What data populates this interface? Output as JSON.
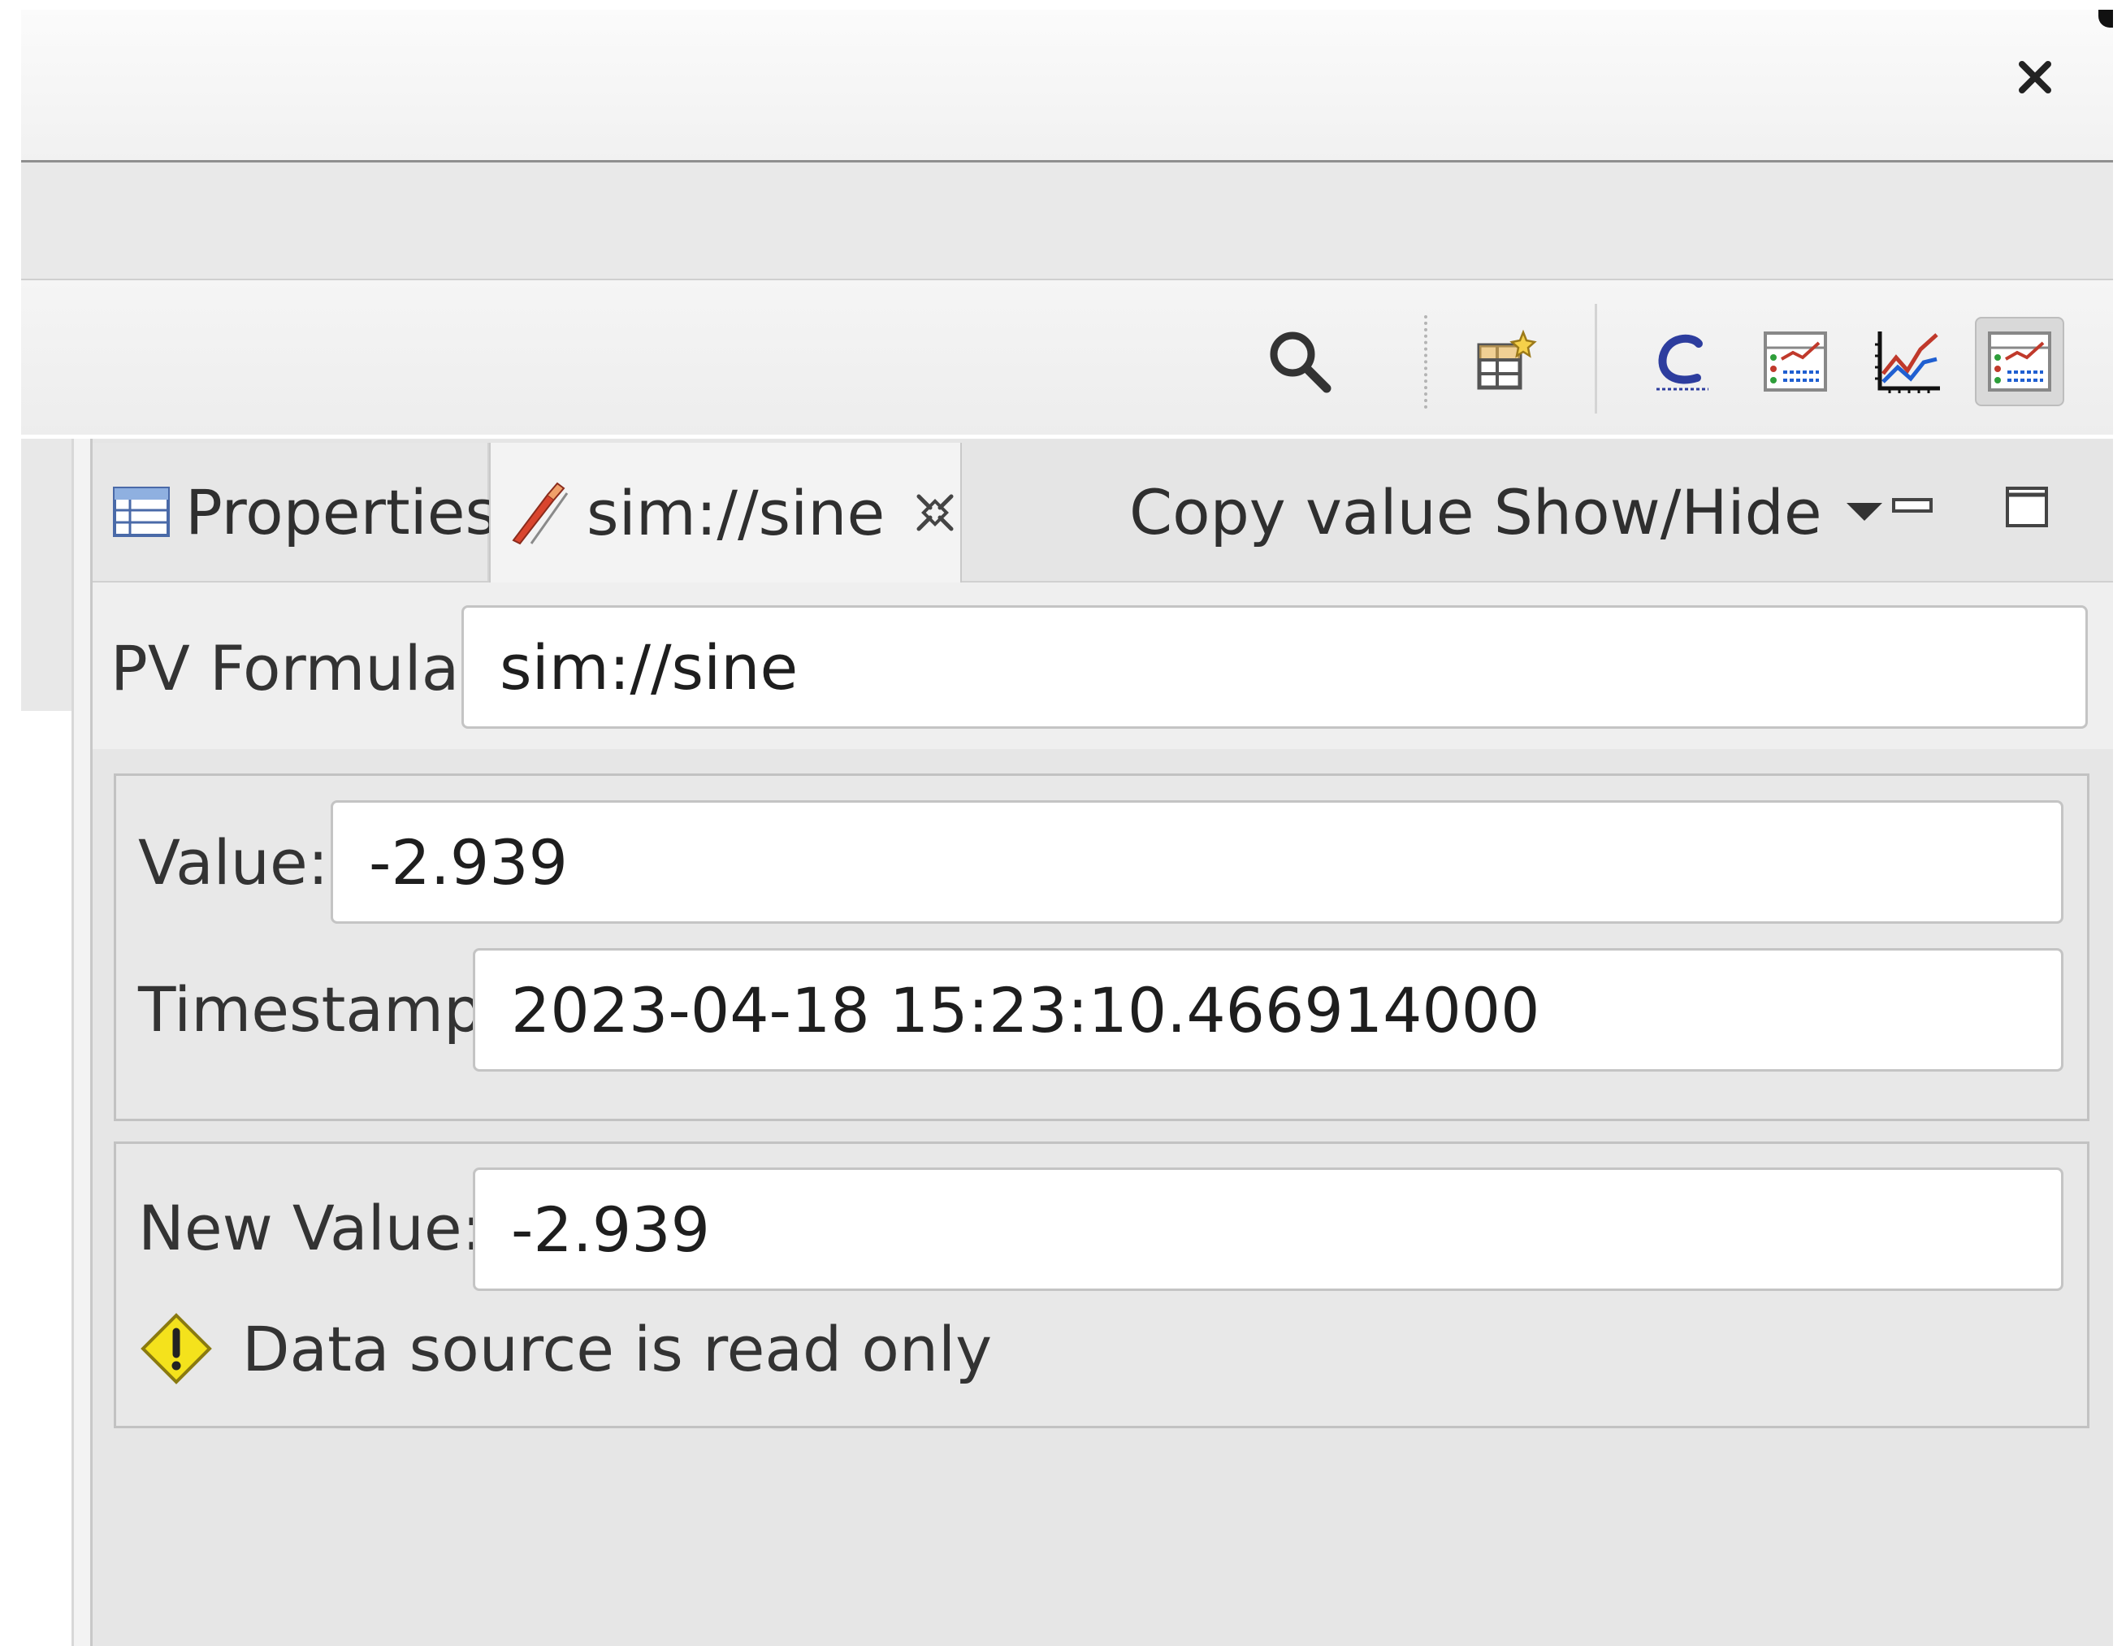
{
  "window": {
    "close_glyph": "✕"
  },
  "toolbar": {
    "items": [
      {
        "name": "search-icon"
      },
      {
        "name": "open-in-table-icon"
      },
      {
        "name": "probe-c-icon"
      },
      {
        "name": "plot-list-icon"
      },
      {
        "name": "xy-plot-icon"
      },
      {
        "name": "probe-pv-icon",
        "pressed": true
      }
    ]
  },
  "view": {
    "tabs": [
      {
        "label": "Properties",
        "icon": "properties-table-icon"
      },
      {
        "label": "sim://sine",
        "icon": "probe-pen-icon",
        "active": true
      }
    ],
    "menu_label": "Copy value Show/Hide",
    "minimize_icon": "minimize-icon",
    "maximize_icon": "maximize-icon"
  },
  "form": {
    "pv_formula_label": "PV Formula:",
    "pv_formula_value": "sim://sine",
    "value_label": "Value:",
    "value_value": "-2.939",
    "timestamp_label": "Timestamp:",
    "timestamp_value": "2023-04-18 15:23:10.466914000",
    "new_value_label": "New Value:",
    "new_value_value": "-2.939",
    "warning_message": "Data source is read only"
  },
  "colors": {
    "accent_red": "#c0392b",
    "warning_yellow": "#f4e21c",
    "plot_blue": "#1f5fd1",
    "plot_green": "#2e9e3a"
  }
}
